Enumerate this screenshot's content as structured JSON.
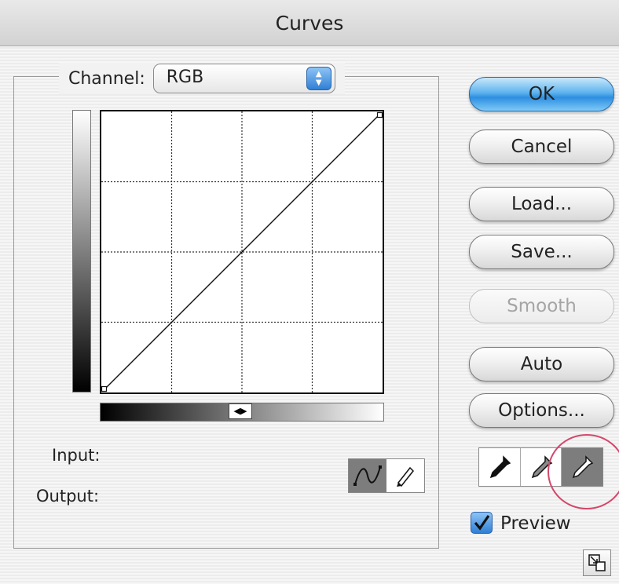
{
  "window": {
    "title": "Curves"
  },
  "channel": {
    "label": "Channel:",
    "value": "RGB"
  },
  "readouts": {
    "input_label": "Input:",
    "output_label": "Output:"
  },
  "buttons": {
    "ok": "OK",
    "cancel": "Cancel",
    "load": "Load...",
    "save": "Save...",
    "smooth": "Smooth",
    "auto": "Auto",
    "options": "Options..."
  },
  "preview": {
    "label": "Preview",
    "checked": true
  },
  "curve": {
    "points": [
      [
        0,
        0
      ],
      [
        255,
        255
      ]
    ],
    "grid_divisions": 4
  },
  "icons": {
    "curve_tool": "curve-tool-icon",
    "pencil_tool": "pencil-tool-icon",
    "black_eyedropper": "black-point-eyedropper-icon",
    "gray_eyedropper": "gray-point-eyedropper-icon",
    "white_eyedropper": "white-point-eyedropper-icon",
    "expand": "expand-icon"
  },
  "colors": {
    "accent": "#2f7fd6",
    "highlight_circle": "#d3476a"
  }
}
